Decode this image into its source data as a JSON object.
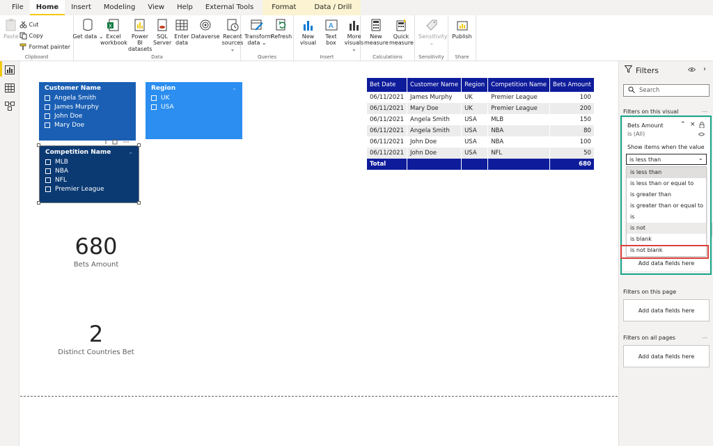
{
  "tabs": [
    "File",
    "Home",
    "Insert",
    "Modeling",
    "View",
    "Help",
    "External Tools",
    "Format",
    "Data / Drill"
  ],
  "ribbon": {
    "clipboard": {
      "paste": "Paste",
      "cut": "Cut",
      "copy": "Copy",
      "format_painter": "Format painter",
      "label": "Clipboard"
    },
    "data": {
      "get_data": "Get data ⌄",
      "excel": "Excel workbook",
      "powerbi": "Power BI datasets",
      "sql": "SQL Server",
      "enter": "Enter data",
      "dataverse": "Dataverse",
      "recent": "Recent sources ⌄",
      "label": "Data"
    },
    "queries": {
      "transform": "Transform data ⌄",
      "refresh": "Refresh",
      "label": "Queries"
    },
    "insert": {
      "new_visual": "New visual",
      "text_box": "Text box",
      "more_visuals": "More visuals ⌄",
      "label": "Insert"
    },
    "calculations": {
      "new_measure": "New measure",
      "quick_measure": "Quick measure",
      "label": "Calculations"
    },
    "sensitivity": {
      "sensitivity": "Sensitivity ⌄",
      "label": "Sensitivity"
    },
    "share": {
      "publish": "Publish",
      "label": "Share"
    }
  },
  "slicers": {
    "customer": {
      "title": "Customer Name",
      "items": [
        "Angela Smith",
        "James Murphy",
        "John Doe",
        "Mary Doe"
      ]
    },
    "region": {
      "title": "Region",
      "items": [
        "UK",
        "USA"
      ]
    },
    "competition": {
      "title": "Competition Name",
      "items": [
        "MLB",
        "NBA",
        "NFL",
        "Premier League"
      ]
    }
  },
  "cards": {
    "bets": {
      "value": "680",
      "label": "Bets Amount"
    },
    "countries": {
      "value": "2",
      "label": "Distinct Countries Bet"
    }
  },
  "table": {
    "headers": [
      "Bet Date",
      "Customer Name",
      "Region",
      "Competition Name",
      "Bets Amount"
    ],
    "rows": [
      [
        "06/11/2021",
        "James Murphy",
        "UK",
        "Premier League",
        "100"
      ],
      [
        "06/11/2021",
        "Mary Doe",
        "UK",
        "Premier League",
        "200"
      ],
      [
        "06/11/2021",
        "Angela Smith",
        "USA",
        "MLB",
        "150"
      ],
      [
        "06/11/2021",
        "Angela Smith",
        "USA",
        "NBA",
        "80"
      ],
      [
        "06/11/2021",
        "John Doe",
        "USA",
        "NBA",
        "100"
      ],
      [
        "06/11/2021",
        "John Doe",
        "USA",
        "NFL",
        "50"
      ]
    ],
    "total_label": "Total",
    "total_value": "680"
  },
  "filters": {
    "title": "Filters",
    "search_placeholder": "Search",
    "on_visual": "Filters on this visual",
    "on_page": "Filters on this page",
    "on_all_pages": "Filters on all pages",
    "dots": "...",
    "card_field": "Bets Amount",
    "card_state": "is (All)",
    "show_items": "Show items when the value",
    "dropdown_value": "is less than",
    "options": [
      "is less than",
      "is less than or equal to",
      "is greater than",
      "is greater than or equal to",
      "is",
      "is not",
      "is blank",
      "is not blank"
    ],
    "add_fields": "Add data fields here"
  },
  "colors": {
    "slicer_dark": "#1a5fb4",
    "slicer_light": "#2b8ef0",
    "slicer_navy": "#0b3a73",
    "table_header": "#0e1c9b",
    "accent": "#f2c811",
    "teal": "#17a589",
    "red": "#d9413a"
  }
}
